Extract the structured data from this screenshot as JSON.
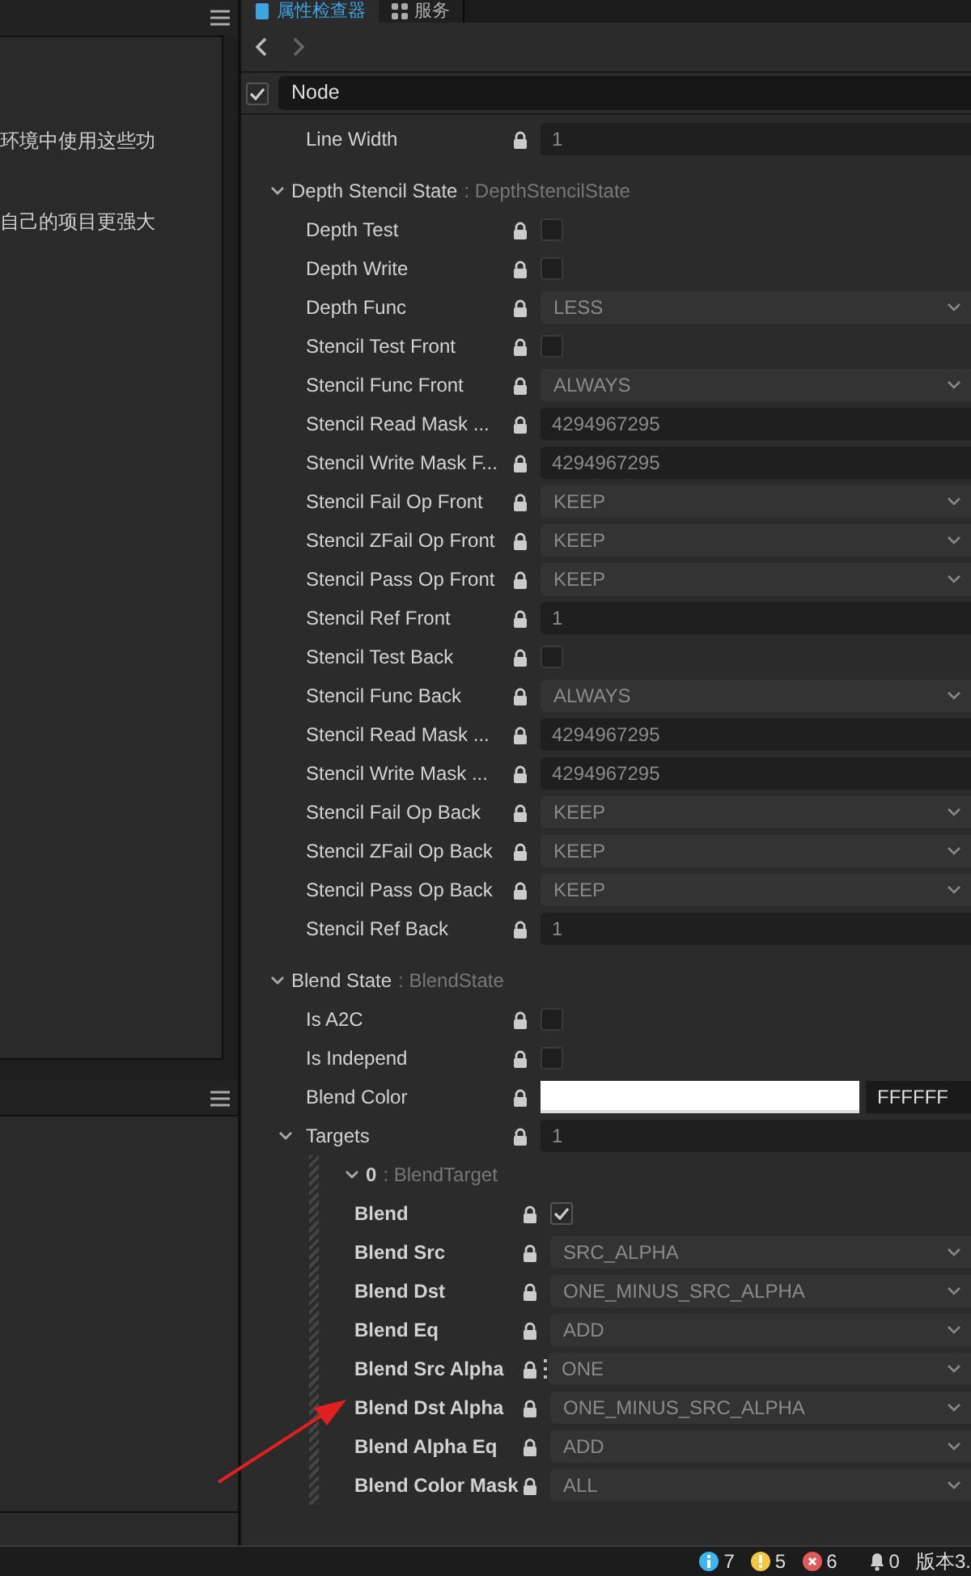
{
  "left_panel": {
    "text_lines": [
      "环境中使用这些功",
      "自己的项目更强大"
    ]
  },
  "tabs": [
    {
      "label": "属性检查器",
      "selected": true,
      "kind": "inspector"
    },
    {
      "label": "服务",
      "selected": false,
      "kind": "services"
    }
  ],
  "node": {
    "label": "Node",
    "checked": true
  },
  "properties": [
    {
      "kind": "number",
      "label": "Line Width",
      "value": "1"
    },
    {
      "kind": "section",
      "label": "Depth Stencil State",
      "type": ": DepthStencilState",
      "expanded": true,
      "children": [
        {
          "kind": "checkbox",
          "label": "Depth Test",
          "checked": false
        },
        {
          "kind": "checkbox",
          "label": "Depth Write",
          "checked": false
        },
        {
          "kind": "select",
          "label": "Depth Func",
          "value": "LESS"
        },
        {
          "kind": "checkbox",
          "label": "Stencil Test Front",
          "checked": false
        },
        {
          "kind": "select",
          "label": "Stencil Func Front",
          "value": "ALWAYS"
        },
        {
          "kind": "number",
          "label": "Stencil Read Mask ...",
          "value": "4294967295"
        },
        {
          "kind": "number",
          "label": "Stencil Write Mask F...",
          "value": "4294967295"
        },
        {
          "kind": "select",
          "label": "Stencil Fail Op Front",
          "value": "KEEP"
        },
        {
          "kind": "select",
          "label": "Stencil ZFail Op Front",
          "value": "KEEP"
        },
        {
          "kind": "select",
          "label": "Stencil Pass Op Front",
          "value": "KEEP"
        },
        {
          "kind": "number",
          "label": "Stencil Ref Front",
          "value": "1"
        },
        {
          "kind": "checkbox",
          "label": "Stencil Test Back",
          "checked": false
        },
        {
          "kind": "select",
          "label": "Stencil Func Back",
          "value": "ALWAYS"
        },
        {
          "kind": "number",
          "label": "Stencil Read Mask ...",
          "value": "4294967295"
        },
        {
          "kind": "number",
          "label": "Stencil Write Mask ...",
          "value": "4294967295"
        },
        {
          "kind": "select",
          "label": "Stencil Fail Op Back",
          "value": "KEEP"
        },
        {
          "kind": "select",
          "label": "Stencil ZFail Op Back",
          "value": "KEEP"
        },
        {
          "kind": "select",
          "label": "Stencil Pass Op Back",
          "value": "KEEP"
        },
        {
          "kind": "number",
          "label": "Stencil Ref Back",
          "value": "1"
        }
      ]
    },
    {
      "kind": "section",
      "label": "Blend State",
      "type": ": BlendState",
      "expanded": true,
      "children": [
        {
          "kind": "checkbox",
          "label": "Is A2C",
          "checked": false
        },
        {
          "kind": "checkbox",
          "label": "Is Independ",
          "checked": false
        },
        {
          "kind": "color",
          "label": "Blend Color",
          "color": "#ffffff",
          "value": "FFFFFF"
        },
        {
          "kind": "array",
          "label": "Targets",
          "value": "1",
          "expanded": true,
          "children": [
            {
              "kind": "section",
              "label": "0",
              "type": ": BlendTarget",
              "expanded": true,
              "children": [
                {
                  "kind": "checkbox",
                  "label": "Blend",
                  "checked": true
                },
                {
                  "kind": "select",
                  "label": "Blend Src",
                  "value": "SRC_ALPHA"
                },
                {
                  "kind": "select",
                  "label": "Blend Dst",
                  "value": "ONE_MINUS_SRC_ALPHA"
                },
                {
                  "kind": "select",
                  "label": "Blend Eq",
                  "value": "ADD"
                },
                {
                  "kind": "select",
                  "label": "Blend Src Alpha",
                  "value": "ONE",
                  "menu": true
                },
                {
                  "kind": "select",
                  "label": "Blend Dst Alpha",
                  "value": "ONE_MINUS_SRC_ALPHA"
                },
                {
                  "kind": "select",
                  "label": "Blend Alpha Eq",
                  "value": "ADD"
                },
                {
                  "kind": "select",
                  "label": "Blend Color Mask",
                  "value": "ALL"
                }
              ]
            }
          ]
        }
      ]
    }
  ],
  "status_bar": {
    "info": "7",
    "warnings": "5",
    "errors": "6",
    "notifications": "0",
    "version": "版本3."
  }
}
